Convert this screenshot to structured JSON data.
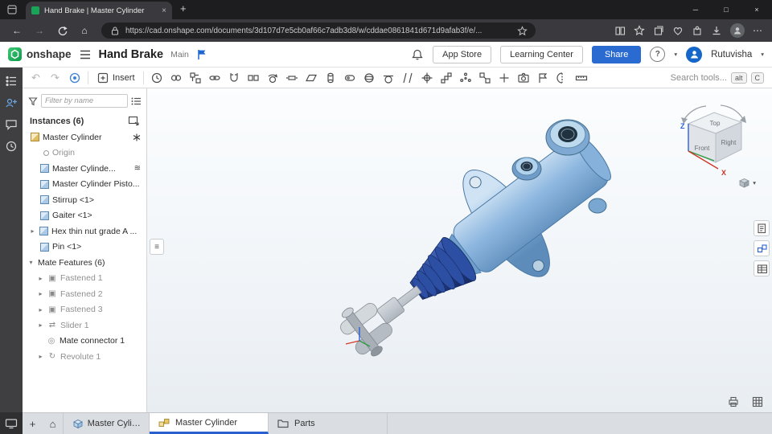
{
  "browser": {
    "tab_title": "Hand Brake | Master Cylinder",
    "url": "https://cad.onshape.com/documents/3d107d7e5cb0af66c7adb3d8/w/cddae0861841d671d9afab3f/e/..."
  },
  "header": {
    "logo_text": "onshape",
    "document_title": "Hand Brake",
    "workspace_label": "Main",
    "app_store_label": "App Store",
    "learning_center_label": "Learning Center",
    "share_label": "Share",
    "user_name": "Rutuvisha"
  },
  "toolbar": {
    "insert_label": "Insert",
    "search_label": "Search tools...",
    "shortcut_alt": "alt",
    "shortcut_key": "C",
    "icon_names": [
      "undo",
      "redo",
      "follow-mode",
      "insert",
      "history",
      "mate",
      "group",
      "relation",
      "snap-mode",
      "fastened",
      "revolute",
      "slider",
      "planar",
      "cylindrical",
      "pin-slot",
      "ball",
      "tangent",
      "parallel",
      "mate-connector",
      "linear-pattern",
      "circular-pattern",
      "replicate",
      "explode",
      "snapshot",
      "named-positions",
      "section-view",
      "measure"
    ]
  },
  "left_strip": {
    "icon_names": [
      "document-outline",
      "follow",
      "comments",
      "history",
      "cast"
    ]
  },
  "left_panel": {
    "filter_placeholder": "Filter by name",
    "instances_header": "Instances (6)",
    "tree": [
      {
        "label": "Master Cylinder",
        "muted": false
      },
      {
        "label": "Origin",
        "muted": true
      },
      {
        "label": "Master Cylinde...",
        "muted": false
      },
      {
        "label": "Master Cylinder Pisto...",
        "muted": false
      },
      {
        "label": "Stirrup <1>",
        "muted": false
      },
      {
        "label": "Gaiter <1>",
        "muted": false
      },
      {
        "label": "Hex thin nut grade A ...",
        "muted": false
      },
      {
        "label": "Pin <1>",
        "muted": false
      },
      {
        "label": "Mate Features (6)",
        "muted": false
      },
      {
        "label": "Fastened 1",
        "muted": true
      },
      {
        "label": "Fastened 2",
        "muted": true
      },
      {
        "label": "Fastened 3",
        "muted": true
      },
      {
        "label": "Slider 1",
        "muted": true
      },
      {
        "label": "Mate connector 1",
        "muted": false
      },
      {
        "label": "Revolute 1",
        "muted": true
      }
    ]
  },
  "viewport": {
    "view_cube": {
      "top": "Top",
      "front": "Front",
      "right": "Right",
      "axis_z": "Z",
      "axis_x": "X"
    }
  },
  "bottom_bar": {
    "tabs": [
      {
        "label": "Master Cylinder",
        "type": "part-studio",
        "active": false
      },
      {
        "label": "Master Cylinder",
        "type": "assembly",
        "active": true
      },
      {
        "label": "Parts",
        "type": "folder",
        "active": false
      }
    ]
  },
  "icons": {
    "close": "×",
    "minimize": "─",
    "maximize": "□",
    "new_tab": "+",
    "back": "←",
    "forward": "→",
    "more": "⋯",
    "undo": "↶",
    "redo": "↷",
    "caret_down": "▾",
    "chevron_right": "▸",
    "chevron_down": "▾",
    "plus": "+",
    "home": "⌂",
    "panel_lines": "≡",
    "waves": "≋",
    "help": "?",
    "fastened": "▣",
    "slider": "⇄",
    "mate_connector": "◎",
    "revolute": "↻"
  }
}
